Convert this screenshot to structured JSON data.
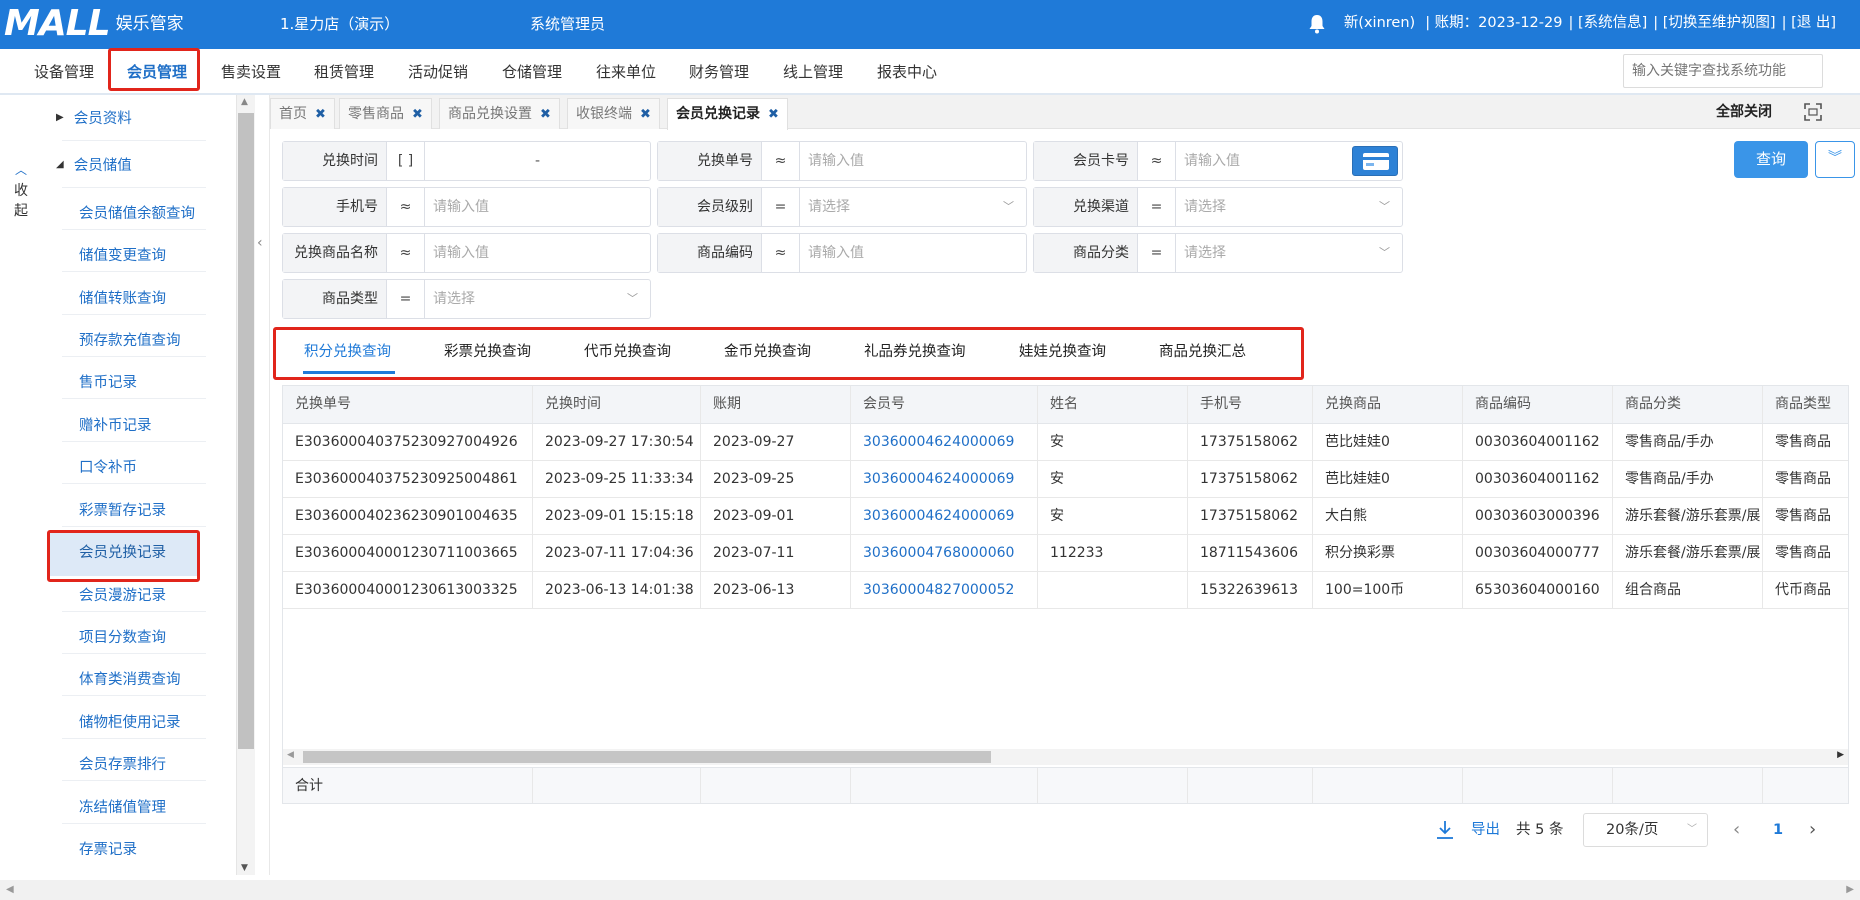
{
  "header": {
    "logo_mark": "MALL",
    "logo_sub": "娱乐管家",
    "store": "1.星力店（演示）",
    "role": "系统管理员",
    "user": "新(xinren)",
    "period": "| 账期：2023-12-29",
    "sys_info": "| [系统信息]",
    "switch_view": "| [切换至维护视图]",
    "logout": "| [退 出]"
  },
  "menu": {
    "items": [
      "设备管理",
      "会员管理",
      "售卖设置",
      "租赁管理",
      "活动促销",
      "仓储管理",
      "往来单位",
      "财务管理",
      "线上管理",
      "报表中心"
    ],
    "search_placeholder": "输入关键字查找系统功能"
  },
  "sidebar": {
    "collapse_label": "收起",
    "groups": [
      "会员资料",
      "会员储值"
    ],
    "items": [
      "会员储值余额查询",
      "储值变更查询",
      "储值转账查询",
      "预存款充值查询",
      "售币记录",
      "赠补币记录",
      "口令补币",
      "彩票暂存记录",
      "会员兑换记录",
      "会员漫游记录",
      "项目分数查询",
      "体育类消费查询",
      "储物柜使用记录",
      "会员存票排行",
      "冻结储值管理",
      "存票记录"
    ]
  },
  "tabs": {
    "items": [
      "首页",
      "零售商品",
      "商品兑换设置",
      "收银终端",
      "会员兑换记录"
    ],
    "close_all": "全部关闭"
  },
  "filters": {
    "exchange_time": {
      "label": "兑换时间",
      "op": "[ ]",
      "value": "-"
    },
    "exchange_no": {
      "label": "兑换单号",
      "op": "≈",
      "placeholder": "请输入值"
    },
    "card_no": {
      "label": "会员卡号",
      "op": "≈",
      "placeholder": "请输入值"
    },
    "phone": {
      "label": "手机号",
      "op": "≈",
      "placeholder": "请输入值"
    },
    "member_level": {
      "label": "会员级别",
      "op": "=",
      "placeholder": "请选择"
    },
    "channel": {
      "label": "兑换渠道",
      "op": "=",
      "placeholder": "请选择"
    },
    "goods_name": {
      "label": "兑换商品名称",
      "op": "≈",
      "placeholder": "请输入值"
    },
    "goods_code": {
      "label": "商品编码",
      "op": "≈",
      "placeholder": "请输入值"
    },
    "goods_category": {
      "label": "商品分类",
      "op": "=",
      "placeholder": "请选择"
    },
    "goods_type": {
      "label": "商品类型",
      "op": "=",
      "placeholder": "请选择"
    },
    "query_label": "查询"
  },
  "subtabs": [
    "积分兑换查询",
    "彩票兑换查询",
    "代币兑换查询",
    "金币兑换查询",
    "礼品券兑换查询",
    "娃娃兑换查询",
    "商品兑换汇总"
  ],
  "table": {
    "columns": [
      "兑换单号",
      "兑换时间",
      "账期",
      "会员号",
      "姓名",
      "手机号",
      "兑换商品",
      "商品编码",
      "商品分类",
      "商品类型"
    ],
    "rows": [
      [
        "E3036000403752309270049​26",
        "2023-09-27 17:30:54",
        "2023-09-27",
        "30360004624000069",
        "安",
        "17375158062",
        "芭比娃娃0",
        "00303604001162",
        "零售商品/手办",
        "零售商品"
      ],
      [
        "E303600040375230925004861",
        "2023-09-25 11:33:34",
        "2023-09-25",
        "30360004624000069",
        "安",
        "17375158062",
        "芭比娃娃0",
        "00303604001162",
        "零售商品/手办",
        "零售商品"
      ],
      [
        "E303600040236230901004635",
        "2023-09-01 15:15:18",
        "2023-09-01",
        "30360004624000069",
        "安",
        "17375158062",
        "大白熊",
        "00303603000396",
        "游乐套餐/游乐套票/展",
        "零售商品"
      ],
      [
        "E303600040001230711003665",
        "2023-07-11 17:04:36",
        "2023-07-11",
        "30360004768000060",
        "112233",
        "18711543606",
        "积分换彩票",
        "00303604000777",
        "游乐套餐/游乐套票/展",
        "零售商品"
      ],
      [
        "E303600040001230613003325",
        "2023-06-13 14:01:38",
        "2023-06-13",
        "30360004827000052",
        "",
        "15322639613",
        "100=100币",
        "65303604000160",
        "组合商品",
        "代币商品"
      ]
    ],
    "footer_label": "合计"
  },
  "pager": {
    "export_label": "导出",
    "total": "共 5 条",
    "page_size": "20条/页",
    "current_page": "1"
  }
}
